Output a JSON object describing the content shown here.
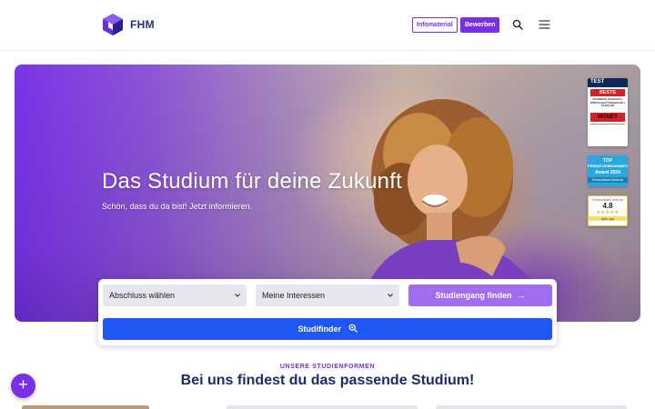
{
  "header": {
    "logo_text": "FHM",
    "info_label": "Infomaterial",
    "apply_label": "Bewerben",
    "search_icon": "search-icon",
    "menu_icon": "hamburger-menu-icon"
  },
  "hero": {
    "title": "Das Studium für deine Zukunft",
    "subtitle": "Schön, dass du da bist! Jetzt informieren.",
    "badges": {
      "test": {
        "head": "TEST",
        "label": "BESTE",
        "lines": "BUSINESS SCHOOLS / WIRTSCHAFTSSCHULEN / SCHULEN",
        "brand": "MONEY"
      },
      "top": {
        "line1": "TOP",
        "line2": "FERNSTUDIENANBIETER",
        "line3": "Award 2024",
        "line4": "FernstudiumCheck.de"
      },
      "score": {
        "source": "FernstudiumCheck.de",
        "score": "4.8",
        "stars": "★★★★★",
        "label": "sehr gut"
      }
    }
  },
  "search": {
    "degree_select": "Abschluss wählen",
    "interests_select": "Meine Interessen",
    "find_button": "Studiengang finden",
    "find_arrow": "→",
    "studifinder_button": "Studifinder"
  },
  "section": {
    "eyebrow": "UNSERE STUDIENFORMEN",
    "title": "Bei uns findest du das passende Studium!"
  },
  "fab": {
    "label": "+"
  },
  "colors": {
    "primary_purple": "#7a2ee6",
    "navy": "#1d2a6e",
    "button_blue": "#1f56f4",
    "button_lilac": "#a06cf0"
  }
}
